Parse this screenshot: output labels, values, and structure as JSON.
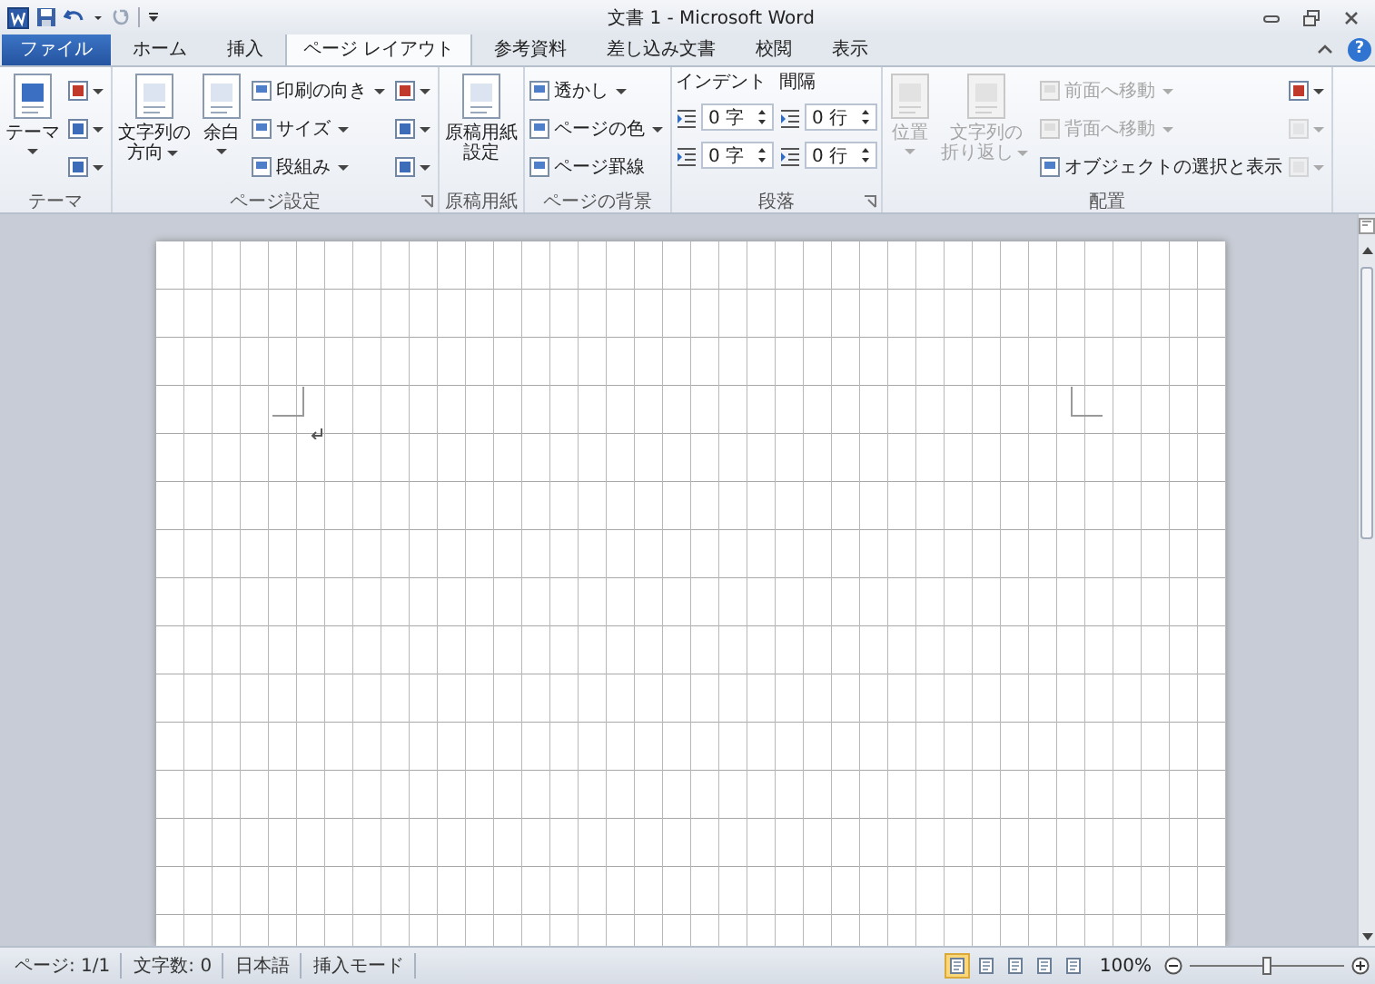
{
  "window": {
    "title": "文書 1 - Microsoft Word"
  },
  "tabs": [
    {
      "label": "ファイル",
      "kind": "file",
      "selected": false
    },
    {
      "label": "ホーム",
      "kind": "tab",
      "selected": false
    },
    {
      "label": "挿入",
      "kind": "tab",
      "selected": false
    },
    {
      "label": "ページ レイアウト",
      "kind": "tab",
      "selected": true
    },
    {
      "label": "参考資料",
      "kind": "tab",
      "selected": false
    },
    {
      "label": "差し込み文書",
      "kind": "tab",
      "selected": false
    },
    {
      "label": "校閲",
      "kind": "tab",
      "selected": false
    },
    {
      "label": "表示",
      "kind": "tab",
      "selected": false
    }
  ],
  "help": "?",
  "ribbon": [
    {
      "label": "テーマ",
      "launcher": false,
      "columns": [
        {
          "kind": "large",
          "lines": [
            "テーマ"
          ],
          "dropdown": true,
          "disabled": false
        },
        {
          "kind": "icons",
          "entries": [
            {
              "disabled": false
            },
            {
              "disabled": false
            },
            {
              "disabled": false
            }
          ]
        }
      ]
    },
    {
      "label": "ページ設定",
      "launcher": true,
      "columns": [
        {
          "kind": "large",
          "lines": [
            "文字列の",
            "方向"
          ],
          "dropdown": true,
          "disabled": false
        },
        {
          "kind": "large",
          "lines": [
            "余白"
          ],
          "dropdown": true,
          "disabled": false
        },
        {
          "kind": "stack",
          "entries": [
            {
              "label": "印刷の向き",
              "dropdown": true,
              "disabled": false
            },
            {
              "label": "サイズ",
              "dropdown": true,
              "disabled": false
            },
            {
              "label": "段組み",
              "dropdown": true,
              "disabled": false
            }
          ]
        },
        {
          "kind": "icons",
          "entries": [
            {
              "disabled": false
            },
            {
              "disabled": false
            },
            {
              "disabled": false
            }
          ]
        }
      ]
    },
    {
      "label": "原稿用紙",
      "launcher": false,
      "columns": [
        {
          "kind": "large",
          "lines": [
            "原稿用紙",
            "設定"
          ],
          "dropdown": false,
          "disabled": false
        }
      ]
    },
    {
      "label": "ページの背景",
      "launcher": false,
      "columns": [
        {
          "kind": "stack",
          "entries": [
            {
              "label": "透かし",
              "dropdown": true,
              "disabled": false
            },
            {
              "label": "ページの色",
              "dropdown": true,
              "disabled": false
            },
            {
              "label": "ページ罫線",
              "dropdown": false,
              "disabled": false
            }
          ]
        }
      ]
    },
    {
      "label": "段落",
      "launcher": true,
      "columns": [
        {
          "kind": "spin",
          "heading": "インデント",
          "entries": [
            {
              "value": "0 字"
            },
            {
              "value": "0 字"
            }
          ]
        },
        {
          "kind": "spin",
          "heading": "間隔",
          "entries": [
            {
              "value": "0 行"
            },
            {
              "value": "0 行"
            }
          ]
        }
      ]
    },
    {
      "label": "配置",
      "launcher": false,
      "columns": [
        {
          "kind": "large",
          "lines": [
            "位置"
          ],
          "dropdown": true,
          "disabled": true
        },
        {
          "kind": "large",
          "lines": [
            "文字列の",
            "折り返し"
          ],
          "dropdown": true,
          "disabled": true
        },
        {
          "kind": "stack",
          "entries": [
            {
              "label": "前面へ移動",
              "dropdown": true,
              "disabled": true
            },
            {
              "label": "背面へ移動",
              "dropdown": true,
              "disabled": true
            },
            {
              "label": "オブジェクトの選択と表示",
              "dropdown": false,
              "disabled": false
            }
          ]
        },
        {
          "kind": "icons",
          "entries": [
            {
              "disabled": false
            },
            {
              "disabled": true
            },
            {
              "disabled": true
            }
          ]
        }
      ]
    }
  ],
  "status_bar": {
    "items": [
      "ページ: 1/1",
      "文字数: 0",
      "日本語",
      "挿入モード"
    ],
    "views": [
      {
        "selected": true
      },
      {
        "selected": false
      },
      {
        "selected": false
      },
      {
        "selected": false
      },
      {
        "selected": false
      }
    ],
    "zoom": "100%",
    "zoom_slider": {
      "level": 0.5
    }
  }
}
